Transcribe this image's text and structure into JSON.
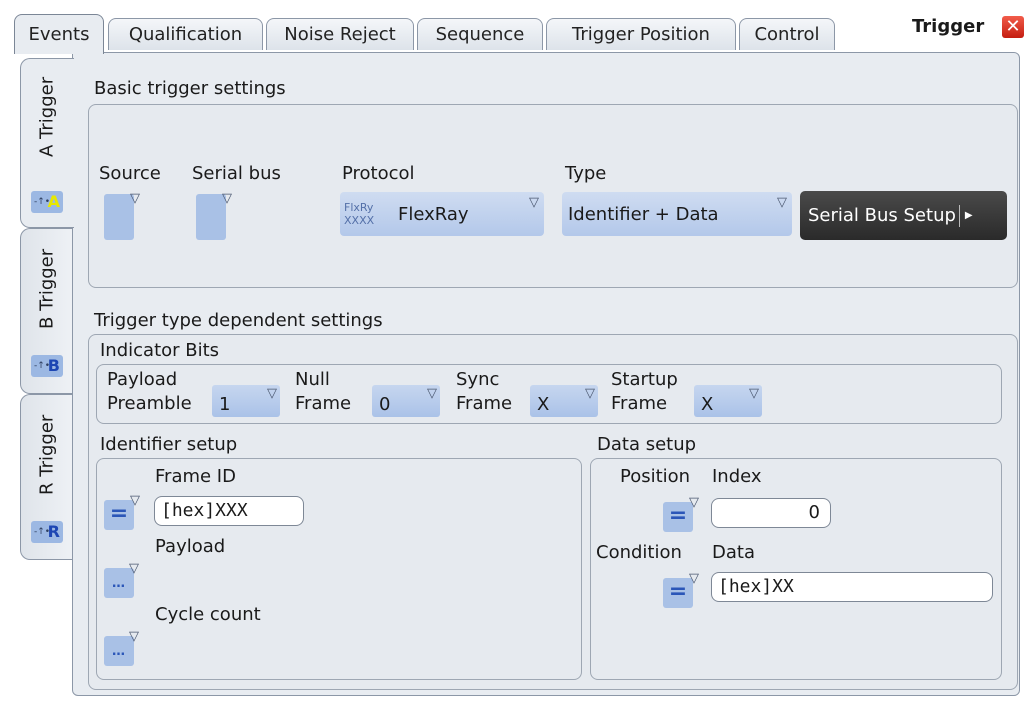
{
  "tabs": [
    {
      "label": "Events",
      "active": true
    },
    {
      "label": "Qualification",
      "active": false
    },
    {
      "label": "Noise Reject",
      "active": false
    },
    {
      "label": "Sequence",
      "active": false
    },
    {
      "label": "Trigger Position",
      "active": false
    },
    {
      "label": "Control",
      "active": false
    }
  ],
  "dialog": {
    "title": "Trigger"
  },
  "side_tabs": [
    {
      "label": "A Trigger",
      "icon_letter": "A",
      "active": true
    },
    {
      "label": "B Trigger",
      "icon_letter": "B",
      "active": false
    },
    {
      "label": "R Trigger",
      "icon_letter": "R",
      "active": false
    }
  ],
  "basic": {
    "title": "Basic trigger settings",
    "source_label": "Source",
    "serial_bus_label": "Serial bus",
    "protocol_label": "Protocol",
    "protocol_value": "FlexRay",
    "protocol_icon_top": "FlxRy",
    "protocol_icon_bottom": "XXXX",
    "type_label": "Type",
    "type_value": "Identifier + Data",
    "setup_button": "Serial Bus Setup"
  },
  "dependent": {
    "title": "Trigger type dependent settings",
    "indicator": {
      "title": "Indicator Bits",
      "items": [
        {
          "label_line1": "Payload",
          "label_line2": "Preamble",
          "value": "1"
        },
        {
          "label_line1": "Null",
          "label_line2": "Frame",
          "value": "0"
        },
        {
          "label_line1": "Sync",
          "label_line2": "Frame",
          "value": "X"
        },
        {
          "label_line1": "Startup",
          "label_line2": "Frame",
          "value": "X"
        }
      ]
    },
    "identifier": {
      "title": "Identifier setup",
      "frame_id_label": "Frame ID",
      "frame_id_value": "[hex]XXX",
      "frame_id_operator": "=",
      "payload_label": "Payload",
      "payload_operator": "…",
      "cycle_label": "Cycle count",
      "cycle_operator": "…"
    },
    "data": {
      "title": "Data setup",
      "position_label": "Position",
      "index_label": "Index",
      "index_value": "0",
      "position_operator": "=",
      "condition_label": "Condition",
      "data_label": "Data",
      "data_value": "[hex]XX",
      "condition_operator": "="
    }
  }
}
